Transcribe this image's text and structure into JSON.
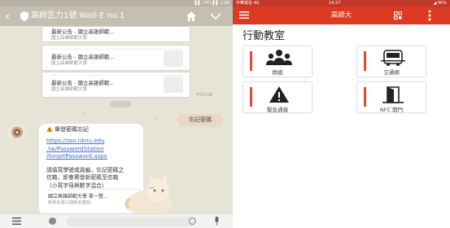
{
  "chat": {
    "status_right": "▌▌ 74% ▌▌ 2:06",
    "title": "高師瓦力1號 Wall-E no.1",
    "cards": [
      {
        "title": "最新公告 - 國立高雄師範...",
        "subtitle": "國立高雄師範大學"
      },
      {
        "title": "最新公告 - 國立高雄師範...",
        "subtitle": "國立高雄師範大學"
      },
      {
        "title": "最新公告 - 國立高雄師範...",
        "subtitle": "國立高雄師範大學"
      }
    ],
    "my_message": "忘記密碼",
    "time_label": "下午2:06",
    "reply": {
      "heading": "單發密碼忘記",
      "link_lines": [
        "https://sso.nknu.edu",
        ".tw/PasswordStation",
        "/forgetPassword.aspx"
      ],
      "body_lines": [
        "請填寫學號或員編，忘記密碼之",
        "信箱，即會寄發新密碼至信箱",
        "（小寫字母與數字混合）"
      ],
      "preview_title": "國立高雄師範大學 單一登...",
      "preview_subtitle": "點擊此處以開啟此連結。"
    }
  },
  "app": {
    "status_left": "中華電信 4G",
    "status_time": "14:27",
    "status_right": "◢ 90%",
    "title": "高師大",
    "section_title": "行動教室",
    "tiles": [
      {
        "label": "群組",
        "icon": "group-icon"
      },
      {
        "label": "交通網",
        "icon": "bus-icon"
      },
      {
        "label": "緊急通報",
        "icon": "warning-icon"
      },
      {
        "label": "NFC 開門",
        "icon": "door-icon"
      }
    ],
    "accent_color": "#dc3a23"
  }
}
